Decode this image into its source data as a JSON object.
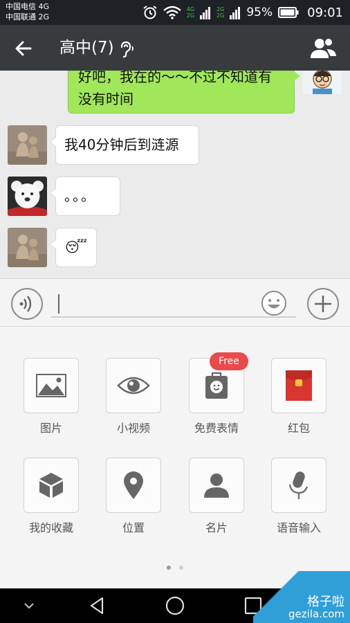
{
  "status_bar": {
    "carrier1": "中国电信 4G",
    "carrier2": "中国联通 2G",
    "net_tag_top": "4G",
    "net_tag_bottom": "2G",
    "net_tag_top2": "2G",
    "net_tag_bottom2": "2G",
    "battery_pct": "95%",
    "time": "09:01"
  },
  "header": {
    "title": "高中(7)",
    "back_icon": "arrow-left-icon",
    "earpiece_icon": "ear-icon",
    "group_icon": "group-members-icon"
  },
  "messages": [
    {
      "side": "right",
      "text": "好吧，我在的～～不过不知道有没有时间"
    },
    {
      "side": "left",
      "text": "我40分钟后到涟源"
    },
    {
      "side": "left",
      "text": "。。。"
    },
    {
      "side": "left",
      "text": "😴"
    }
  ],
  "input_bar": {
    "value": "",
    "voice_icon": "voice-icon",
    "emoji_icon": "emoji-icon",
    "plus_icon": "plus-icon"
  },
  "panel": {
    "items": [
      {
        "label": "图片",
        "icon": "image-icon"
      },
      {
        "label": "小视频",
        "icon": "eye-icon"
      },
      {
        "label": "免费表情",
        "icon": "sticker-icon",
        "badge": "Free"
      },
      {
        "label": "红包",
        "icon": "red-envelope-icon"
      },
      {
        "label": "我的收藏",
        "icon": "box-icon"
      },
      {
        "label": "位置",
        "icon": "location-pin-icon"
      },
      {
        "label": "名片",
        "icon": "contact-card-icon"
      },
      {
        "label": "语音输入",
        "icon": "microphone-icon"
      }
    ]
  },
  "watermark": {
    "cn": "格子啦",
    "en": "gezila.com"
  },
  "colors": {
    "header_bg": "#373b3e",
    "status_bg": "#1e2226",
    "my_bubble": "#a0e75a",
    "badge_red": "#e94a4a",
    "envelope_red": "#d9362f"
  }
}
